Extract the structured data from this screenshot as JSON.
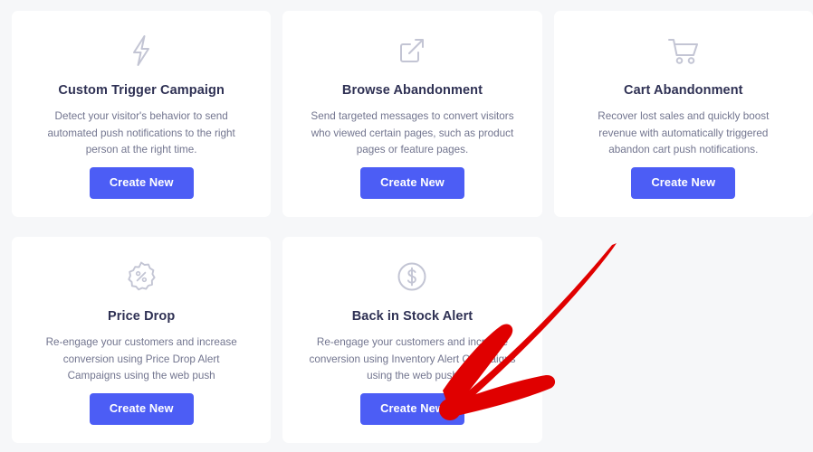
{
  "theme": {
    "page_background": "#f6f7f9",
    "card_background": "#ffffff",
    "title_color": "#2f3154",
    "description_color": "#72758f",
    "button_color": "#4c5df5",
    "button_text_color": "#ffffff",
    "icon_color": "#c3c5d4",
    "annotation_color": "#e00000"
  },
  "cards": [
    {
      "icon": "lightning-bolt-icon",
      "title": "Custom Trigger Campaign",
      "description": "Detect your visitor's behavior to send automated push notifications to the right person at the right time.",
      "button_label": "Create New"
    },
    {
      "icon": "external-link-icon",
      "title": "Browse Abandonment",
      "description": "Send targeted messages to convert visitors who viewed certain pages, such as product pages or feature pages.",
      "button_label": "Create New"
    },
    {
      "icon": "shopping-cart-icon",
      "title": "Cart Abandonment",
      "description": "Recover lost sales and quickly boost revenue with automatically triggered abandon cart push notifications.",
      "button_label": "Create New"
    },
    {
      "icon": "percent-badge-icon",
      "title": "Price Drop",
      "description": "Re-engage your customers and increase conversion using Price Drop Alert Campaigns using the web push",
      "button_label": "Create New"
    },
    {
      "icon": "dollar-circle-icon",
      "title": "Back in Stock Alert",
      "description": "Re-engage your customers and increase conversion using Inventory Alert Campaigns using the web push",
      "button_label": "Create New"
    }
  ],
  "annotation": {
    "name": "red-curved-arrow",
    "points_to": "Back in Stock Alert Create New",
    "color": "#e00000"
  }
}
